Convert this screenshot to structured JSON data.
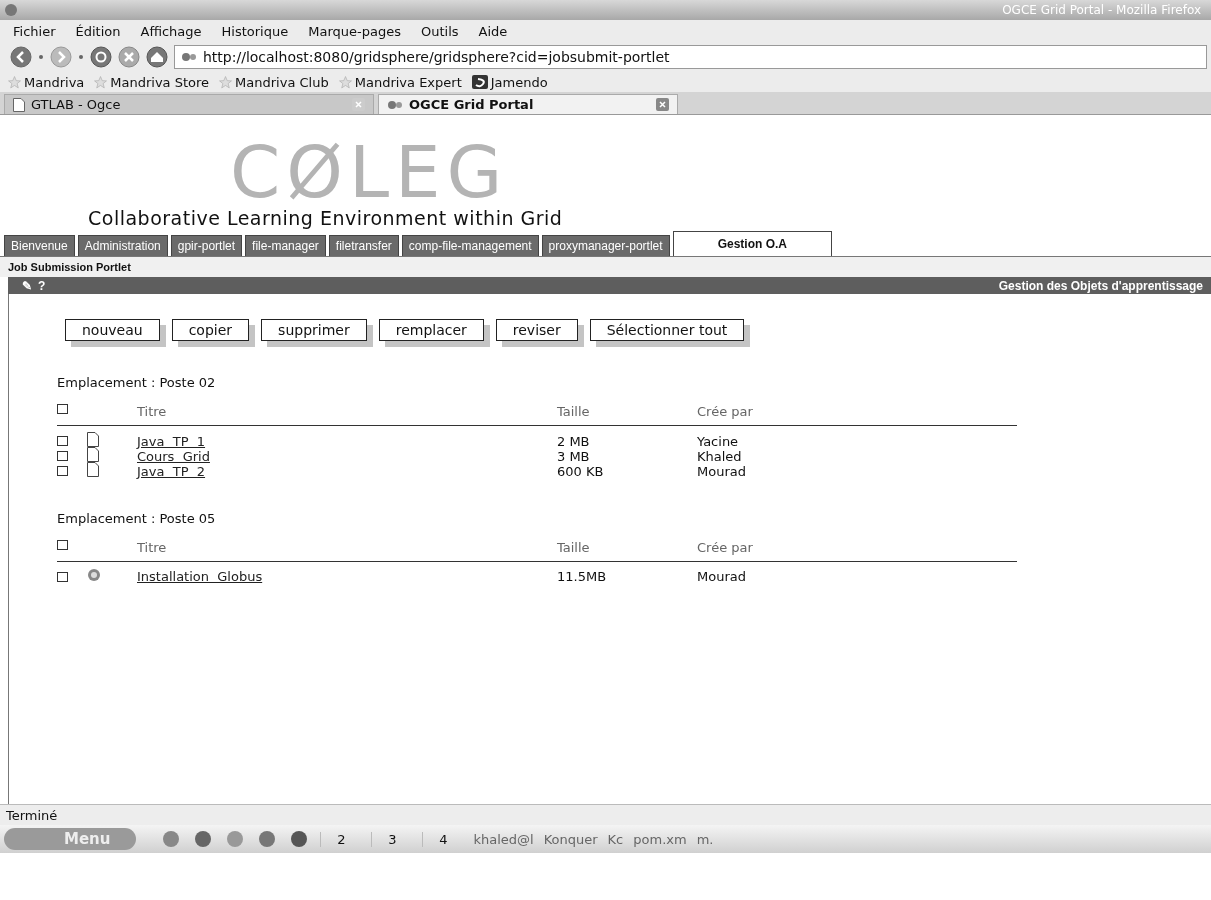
{
  "window": {
    "title": "OGCE Grid Portal - Mozilla Firefox"
  },
  "menu": [
    "Fichier",
    "Édition",
    "Affichage",
    "Historique",
    "Marque-pages",
    "Outils",
    "Aide"
  ],
  "address": {
    "value": "http://localhost:8080/gridsphere/gridsphere?cid=jobsubmit-portlet"
  },
  "bookmarks": [
    {
      "label": "Mandriva",
      "kind": "star"
    },
    {
      "label": "Mandriva Store",
      "kind": "star"
    },
    {
      "label": "Mandriva Club",
      "kind": "star"
    },
    {
      "label": "Mandriva Expert",
      "kind": "star"
    },
    {
      "label": "Jamendo",
      "kind": "logo"
    }
  ],
  "browser_tabs": [
    {
      "label": "GTLAB - Ogce",
      "selected": false
    },
    {
      "label": "OGCE Grid Portal",
      "selected": true
    }
  ],
  "logo": {
    "text": "CØLEG",
    "subtitle": "Collaborative Learning Environment within Grid"
  },
  "portal_tabs": [
    {
      "label": "Bienvenue",
      "selected": false
    },
    {
      "label": "Administration",
      "selected": false
    },
    {
      "label": "gpir-portlet",
      "selected": false
    },
    {
      "label": "file-manager",
      "selected": false
    },
    {
      "label": "filetransfer",
      "selected": false
    },
    {
      "label": "comp-file-management",
      "selected": false
    },
    {
      "label": "proxymanager-portlet",
      "selected": false
    },
    {
      "label": "Gestion O.A",
      "selected": true
    }
  ],
  "subtab": "Job Submission Portlet",
  "portlet": {
    "icons": [
      "✎",
      "?"
    ],
    "title": "Gestion des Objets d'apprentissage"
  },
  "actions": [
    "nouveau",
    "copier",
    "supprimer",
    "remplacer",
    "reviser",
    "Sélectionner tout"
  ],
  "sections": [
    {
      "location": "Emplacement :  Poste 02",
      "select_all_checked": false,
      "columns": [
        "Titre",
        "Taille",
        "Crée par"
      ],
      "rows": [
        {
          "kind": "file",
          "title": "Java  TP  1",
          "size": "2 MB",
          "author": "Yacine",
          "checked": false
        },
        {
          "kind": "file",
          "title": "Cours  Grid",
          "size": "3 MB",
          "author": "Khaled",
          "checked": false
        },
        {
          "kind": "file",
          "title": "Java  TP  2",
          "size": "600 KB",
          "author": "Mourad",
          "checked": false
        }
      ]
    },
    {
      "location": "Emplacement :  Poste 05",
      "select_all_checked": false,
      "columns": [
        "Titre",
        "Taille",
        "Crée par"
      ],
      "rows": [
        {
          "kind": "app",
          "title": "Installation  Globus",
          "size": "11.5MB",
          "author": "Mourad",
          "checked": false
        }
      ]
    }
  ],
  "status_bar": "Terminé",
  "taskbar": {
    "menu": "Menu",
    "desktops": [
      "2",
      "3",
      "4"
    ],
    "tasks": [
      "khaled@l",
      "Konquer",
      "Kc",
      "pom.xm",
      "m."
    ]
  }
}
